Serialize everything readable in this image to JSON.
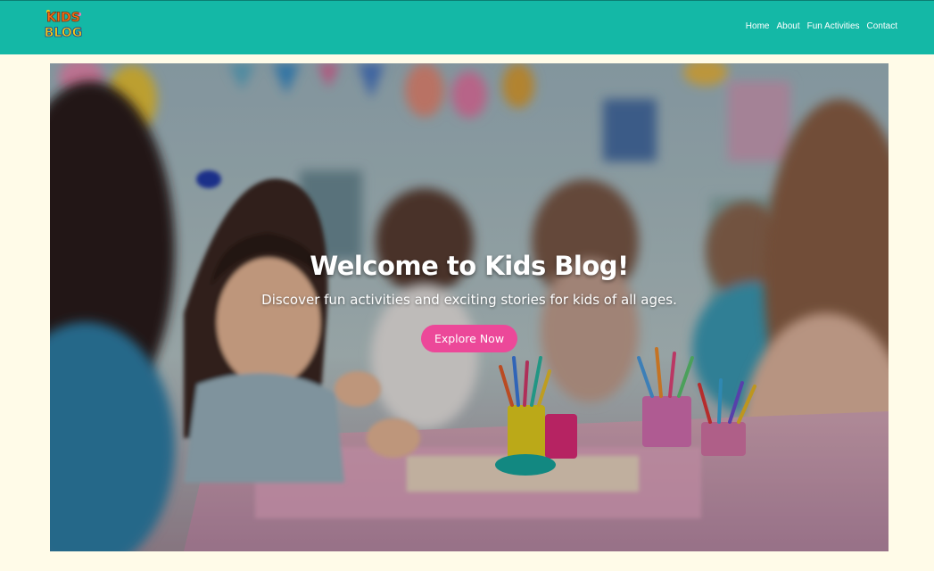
{
  "brand": {
    "logo_line1": "KIDS",
    "logo_line2": "BLOG"
  },
  "nav": {
    "items": [
      {
        "label": "Home"
      },
      {
        "label": "About"
      },
      {
        "label": "Fun Activities"
      },
      {
        "label": "Contact"
      }
    ]
  },
  "hero": {
    "title": "Welcome to Kids Blog!",
    "subtitle": "Discover fun activities and exciting stories for kids of all ages.",
    "cta_label": "Explore Now"
  },
  "colors": {
    "navbar": "#14b8a6",
    "page_background": "#fffbe8",
    "cta": "#ec4899"
  }
}
